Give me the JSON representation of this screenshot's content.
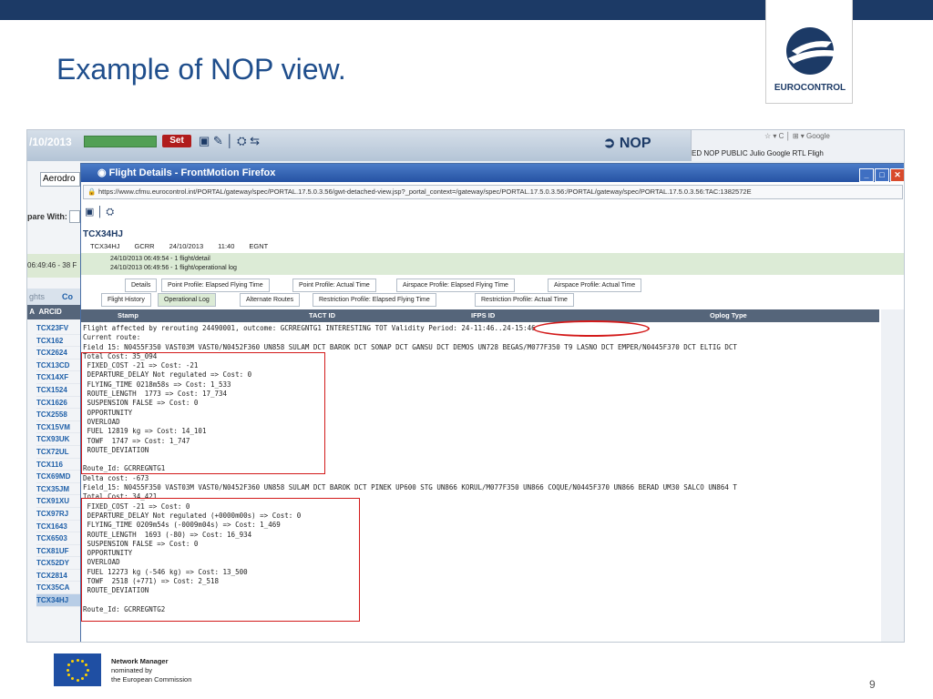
{
  "slide": {
    "title": "Example of NOP view.",
    "logo_text": "EUROCONTROL",
    "footer_line1": "Network Manager",
    "footer_line2": "nominated by",
    "footer_line3": "the European Commission",
    "page_number": "9"
  },
  "app": {
    "date_fragment": "/10/2013",
    "set_label": "Set",
    "nop_label": "NOP",
    "aerodrome_label": "Aerodro",
    "compare_label": "pare With:",
    "time_strip": "06:49:46 - 38 F",
    "tab_left_1": "ghts",
    "tab_left_2": "Co",
    "arcid_header": "ARCID",
    "arcids": [
      "TCX23FV",
      "TCX162",
      "TCX2624",
      "TCX13CD",
      "TCX14XF",
      "TCX1524",
      "TCX1626",
      "TCX2558",
      "TCX15VM",
      "TCX93UK",
      "TCX72UL",
      "TCX116",
      "TCX69MD",
      "TCX35JM",
      "TCX91XU",
      "TCX97RJ",
      "TCX1643",
      "TCX6503",
      "TCX81UF",
      "TCX52DY",
      "TCX2814",
      "TCX35CA",
      "TCX34HJ"
    ],
    "selected_arcid": "TCX34HJ"
  },
  "firefox": {
    "search_placeholder": "Google",
    "bookmarks": "ED   NOP PUBLIC   Julio   Google   RTL   Fligh"
  },
  "window": {
    "title": "Flight Details - FrontMotion Firefox",
    "url": "https://www.cfmu.eurocontrol.int/PORTAL/gateway/spec/PORTAL.17.5.0.3.56/gwt-detached-view.jsp?_portal_context=/gateway/spec/PORTAL.17.5.0.3.56:/PORTAL/gateway/spec/PORTAL.17.5.0.3.56:TAC:1382572E",
    "aircraft_id": "TCX34HJ",
    "header_fields": [
      "TCX34HJ",
      "GCRR",
      "24/10/2013",
      "11:40",
      "EGNT"
    ],
    "history": [
      "24/10/2013 06:49:54 - 1 flight/detail",
      "24/10/2013 06:49:56 - 1 flight/operational log"
    ],
    "tabs_row1": [
      "Details",
      "Point Profile: Elapsed Flying Time",
      "Point Profile: Actual Time",
      "Airspace Profile: Elapsed Flying Time",
      "Airspace Profile: Actual Time"
    ],
    "tabs_row2": [
      "Flight History",
      "Operational Log",
      "Alternate Routes",
      "Restriction Profile: Elapsed Flying Time",
      "Restriction Profile: Actual Time"
    ],
    "active_tab": "Operational Log",
    "columns": [
      "Stamp",
      "TACT ID",
      "IFPS ID",
      "Oplog Type"
    ],
    "log_lines": [
      "Flight affected by rerouting 24490001, outcome: GCRREGNTG1 INTERESTING TOT Validity Period: 24-11:46..24-15:46",
      "Current route:",
      "Field 15: N0455F350 VAST03M VAST0/N0452F360 UN858 SULAM DCT BAROK DCT SONAP DCT GANSU DCT DEMOS UN728 BEGAS/M077F350 T9 LASNO DCT EMPER/N0445F370 DCT ELTIG DCT",
      "Total Cost: 35_094",
      " FIXED_COST -21 => Cost: -21",
      " DEPARTURE_DELAY Not regulated => Cost: 0",
      " FLYING_TIME 0218m58s => Cost: 1_533",
      " ROUTE_LENGTH  1773 => Cost: 17_734",
      " SUSPENSION FALSE => Cost: 0",
      " OPPORTUNITY",
      " OVERLOAD",
      " FUEL 12819 kg => Cost: 14_101",
      " TOWF  1747 => Cost: 1_747",
      " ROUTE_DEVIATION",
      "",
      "Route_Id: GCRREGNTG1",
      "Delta cost: -673",
      "Field_15: N0455F350 VAST03M VAST0/N0452F360 UN858 SULAM DCT BAROK DCT PINEK UP600 STG UN866 KORUL/M077F350 UN866 COQUE/N0445F370 UN866 BERAD UM30 SALCO UN864 T",
      "Total Cost: 34_421",
      " FIXED_COST -21 => Cost: 0",
      " DEPARTURE_DELAY Not regulated (+0000m00s) => Cost: 0",
      " FLYING_TIME 0209m54s (-0009m04s) => Cost: 1_469",
      " ROUTE_LENGTH  1693 (-80) => Cost: 16_934",
      " SUSPENSION FALSE => Cost: 0",
      " OPPORTUNITY",
      " OVERLOAD",
      " FUEL 12273 kg (-546 kg) => Cost: 13_500",
      " TOWF  2518 (+771) => Cost: 2_518",
      " ROUTE_DEVIATION",
      "",
      "Route_Id: GCRREGNTG2"
    ]
  }
}
